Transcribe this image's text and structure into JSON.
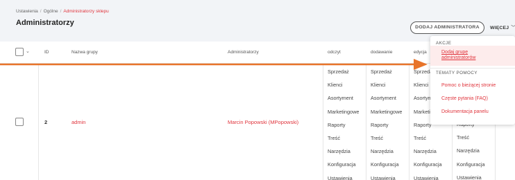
{
  "breadcrumb": [
    "Ustawienia",
    "Ogólne",
    "Administratorzy sklepu"
  ],
  "breadcrumb_separator": "/",
  "page_title": "Administratorzy",
  "toolbar": {
    "add_label": "DODAJ ADMINISTRATORA",
    "more_label": "WIĘCEJ",
    "more_icon": "chevron-down-icon"
  },
  "table": {
    "headers": {
      "id": "ID",
      "group": "Nazwa grupy",
      "admins": "Administratorzy",
      "read": "odczyt",
      "add": "dodawanie",
      "edit": "edycja"
    },
    "row": {
      "id": "2",
      "group": "admin",
      "admins": "Marcin Popowski (MPopowski)",
      "read": [
        "Sprzedaż",
        "Klienci",
        "Asortyment",
        "Marketingowe",
        "Raporty",
        "Treść",
        "Narzędzia",
        "Konfiguracja",
        "Ustawienia"
      ],
      "add": [
        "Sprzedaż",
        "Klienci",
        "Asortyment",
        "Marketingowe",
        "Raporty",
        "Treść",
        "Narzędzia",
        "Konfiguracja",
        "Ustawienia"
      ],
      "edit": [
        "Sprzedaż",
        "Klienci",
        "Asortyment",
        "Marketingowe",
        "Raporty",
        "Treść",
        "Narzędzia",
        "Konfiguracja",
        "Ustawienia"
      ],
      "extra": [
        "Raporty",
        "Treść",
        "Narzędzia",
        "Konfiguracja",
        "Ustawienia"
      ]
    }
  },
  "dropdown": {
    "section_actions": "AKCJE",
    "add_group": "Dodaj grupę administratorów",
    "section_help": "TEMATY POMOCY",
    "help_items": [
      "Pomoc o bieżącej stronie",
      "Częste pytania (FAQ)",
      "Dokumentacja panelu"
    ]
  },
  "colors": {
    "accent": "#e0353d",
    "arrow": "#e8742a",
    "highlight": "#fdecec"
  }
}
